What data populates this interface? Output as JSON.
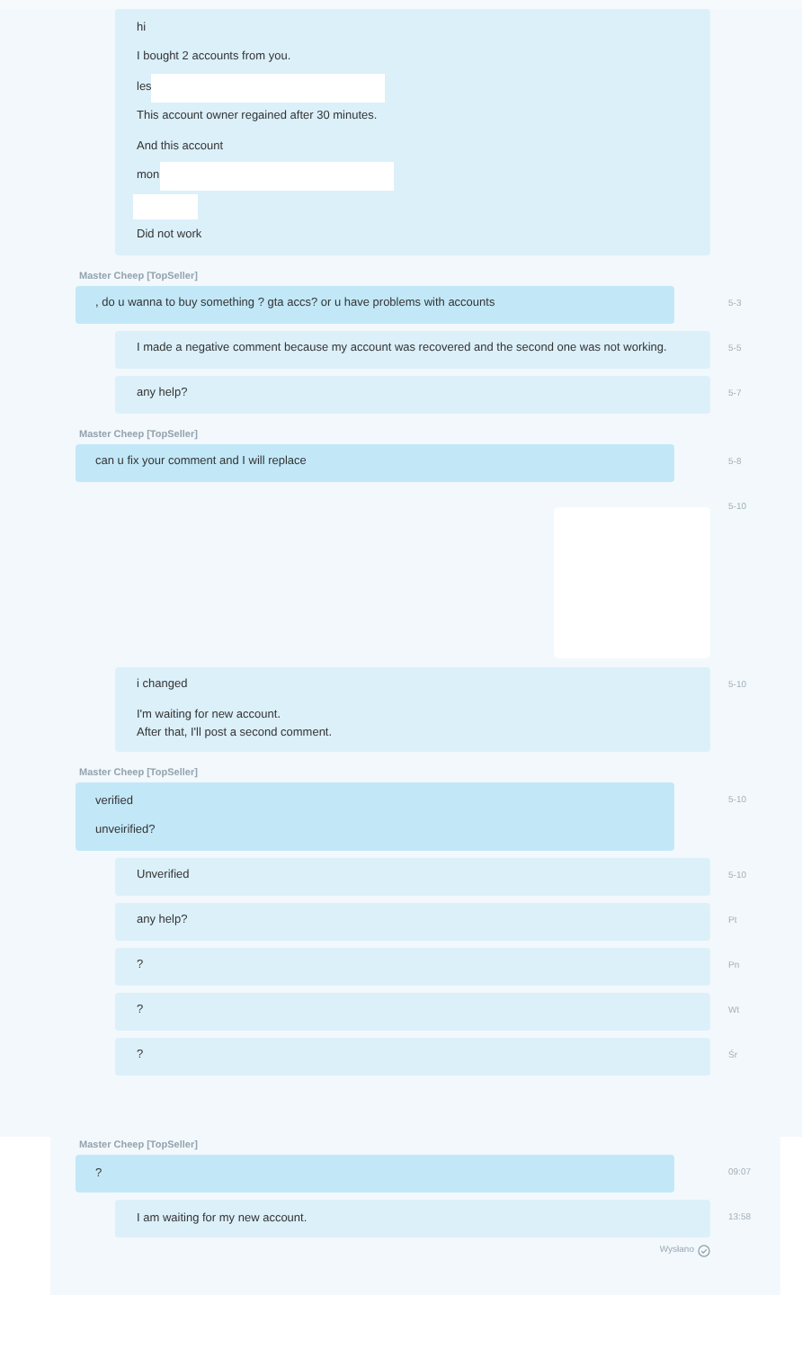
{
  "sections": [
    {
      "items": [
        {
          "kind": "message",
          "incoming": false,
          "lines": [
            {
              "kind": "text",
              "text": "hi"
            },
            {
              "kind": "text",
              "text": "I bought 2 accounts from you."
            },
            {
              "kind": "redacted",
              "text": "les"
            },
            {
              "kind": "text",
              "text": "This account owner regained after 30 minutes."
            },
            {
              "kind": "text",
              "text": "And this account"
            },
            {
              "kind": "redacted",
              "text": "mon"
            },
            {
              "kind": "redacted"
            },
            {
              "kind": "text",
              "text": "Did not work"
            }
          ]
        },
        {
          "kind": "sender",
          "text": "Master Cheep [TopSeller]"
        },
        {
          "kind": "message",
          "incoming": true,
          "time": "5-3",
          "lines": [
            {
              "kind": "text",
              "text": ", do u wanna to buy something ? gta accs?  or u have problems with accounts"
            }
          ]
        },
        {
          "kind": "message",
          "incoming": false,
          "time": "5-5",
          "lines": [
            {
              "kind": "text",
              "text": "I made a negative comment because my account was recovered and the second one was not working."
            }
          ]
        },
        {
          "kind": "message",
          "incoming": false,
          "time": "5-7",
          "lines": [
            {
              "kind": "text",
              "text": "any help?"
            }
          ]
        },
        {
          "kind": "sender",
          "text": "Master Cheep [TopSeller]"
        },
        {
          "kind": "message",
          "incoming": true,
          "time": "5-8",
          "lines": [
            {
              "kind": "text",
              "text": "can u fix your comment and I will replace"
            }
          ]
        },
        {
          "kind": "attachment",
          "time": "5-10"
        },
        {
          "kind": "message",
          "incoming": false,
          "time": "5-10",
          "lines": [
            {
              "kind": "text",
              "text": "i changed"
            },
            {
              "kind": "text",
              "text": "I'm waiting for new account.\nAfter that, I'll post a second comment."
            }
          ]
        },
        {
          "kind": "sender",
          "text": "Master Cheep [TopSeller]"
        },
        {
          "kind": "message",
          "incoming": true,
          "time": "5-10",
          "lines": [
            {
              "kind": "text",
              "text": "verified"
            },
            {
              "kind": "text",
              "text": "unveirified?"
            }
          ]
        },
        {
          "kind": "message",
          "incoming": false,
          "time": "5-10",
          "lines": [
            {
              "kind": "text",
              "text": "Unverified"
            }
          ]
        },
        {
          "kind": "message",
          "incoming": false,
          "time": "Pt",
          "lines": [
            {
              "kind": "text",
              "text": "any help?"
            }
          ]
        },
        {
          "kind": "message",
          "incoming": false,
          "time": "Pn",
          "lines": [
            {
              "kind": "text",
              "text": "?"
            }
          ]
        },
        {
          "kind": "message",
          "incoming": false,
          "time": "Wt",
          "lines": [
            {
              "kind": "text",
              "text": "?"
            }
          ]
        },
        {
          "kind": "message",
          "incoming": false,
          "time": "Śr",
          "lines": [
            {
              "kind": "text",
              "text": "?"
            }
          ]
        }
      ]
    },
    {
      "items": [
        {
          "kind": "sender",
          "text": "Master Cheep [TopSeller]"
        },
        {
          "kind": "message",
          "incoming": true,
          "time": "09:07",
          "lines": [
            {
              "kind": "text",
              "text": "?"
            }
          ]
        },
        {
          "kind": "message",
          "incoming": false,
          "time": "13:58",
          "lines": [
            {
              "kind": "text",
              "text": "I am waiting for my new account."
            }
          ]
        },
        {
          "kind": "status",
          "text": "Wysłano"
        }
      ]
    }
  ]
}
